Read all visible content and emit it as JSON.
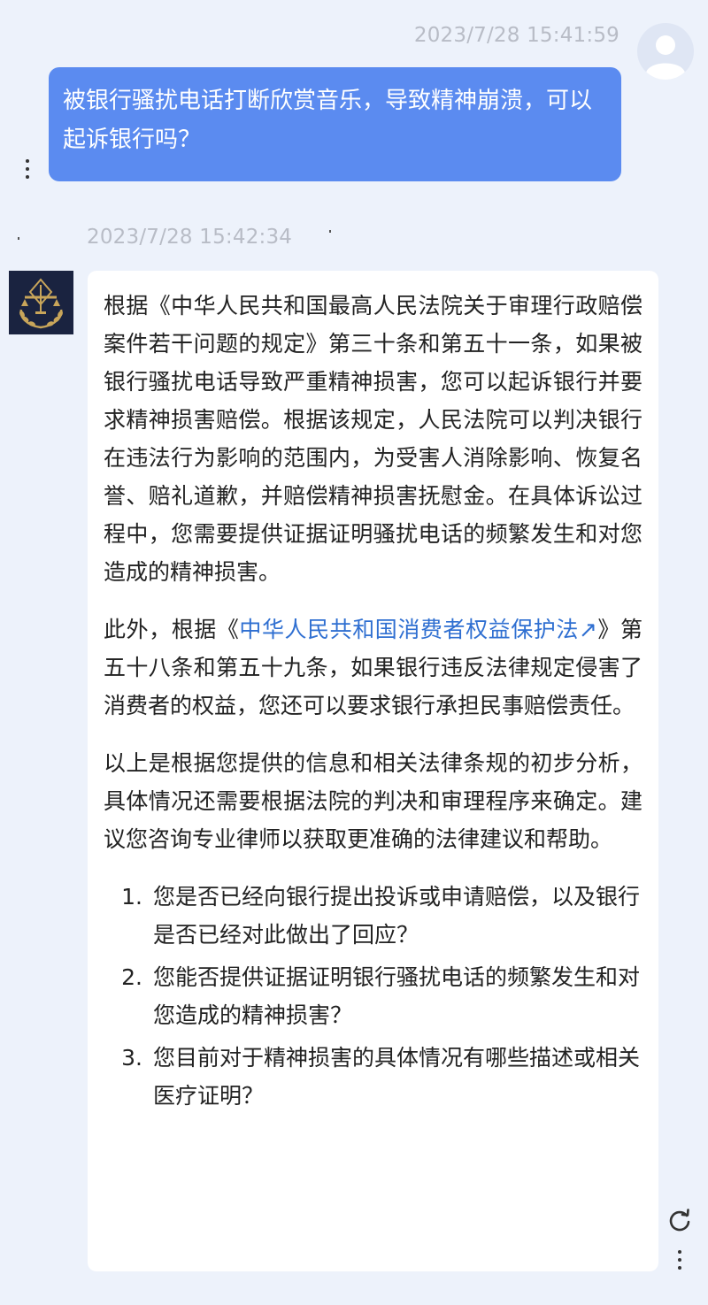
{
  "user_message": {
    "timestamp": "2023/7/28 15:41:59",
    "text": "被银行骚扰电话打断欣赏音乐，导致精神崩溃，可以起诉银行吗？"
  },
  "bot_message": {
    "timestamp": "2023/7/28 15:42:34",
    "paragraphs": {
      "p1": "根据《中华人民共和国最高人民法院关于审理行政赔偿案件若干问题的规定》第三十条和第五十一条，如果被银行骚扰电话导致严重精神损害，您可以起诉银行并要求精神损害赔偿。根据该规定，人民法院可以判决银行在违法行为影响的范围内，为受害人消除影响、恢复名誉、赔礼道歉，并赔偿精神损害抚慰金。在具体诉讼过程中，您需要提供证据证明骚扰电话的频繁发生和对您造成的精神损害。",
      "p2_prefix": "此外，根据《",
      "p2_link": "中华人民共和国消费者权益保护法↗",
      "p2_suffix": "》第五十八条和第五十九条，如果银行违反法律规定侵害了消费者的权益，您还可以要求银行承担民事赔偿责任。",
      "p3": "以上是根据您提供的信息和相关法律条规的初步分析，具体情况还需要根据法院的判决和审理程序来确定。建议您咨询专业律师以获取更准确的法律建议和帮助。"
    },
    "questions": [
      {
        "num": "1.",
        "text": "您是否已经向银行提出投诉或申请赔偿，以及银行是否已经对此做出了回应？"
      },
      {
        "num": "2.",
        "text": "您能否提供证据证明银行骚扰电话的频繁发生和对您造成的精神损害？"
      },
      {
        "num": "3.",
        "text": "您目前对于精神损害的具体情况有哪些描述或相关医疗证明？"
      }
    ]
  },
  "icons": {
    "user_avatar": "user-avatar-icon",
    "bot_avatar": "law-scales-logo",
    "more": "more-vertical-icon",
    "refresh": "refresh-icon"
  },
  "colors": {
    "background": "#edf2fb",
    "user_bubble": "#5b8bf0",
    "link": "#2f6fd1",
    "bot_logo_bg": "#1a2340",
    "bot_logo_gold": "#c8a55a"
  }
}
